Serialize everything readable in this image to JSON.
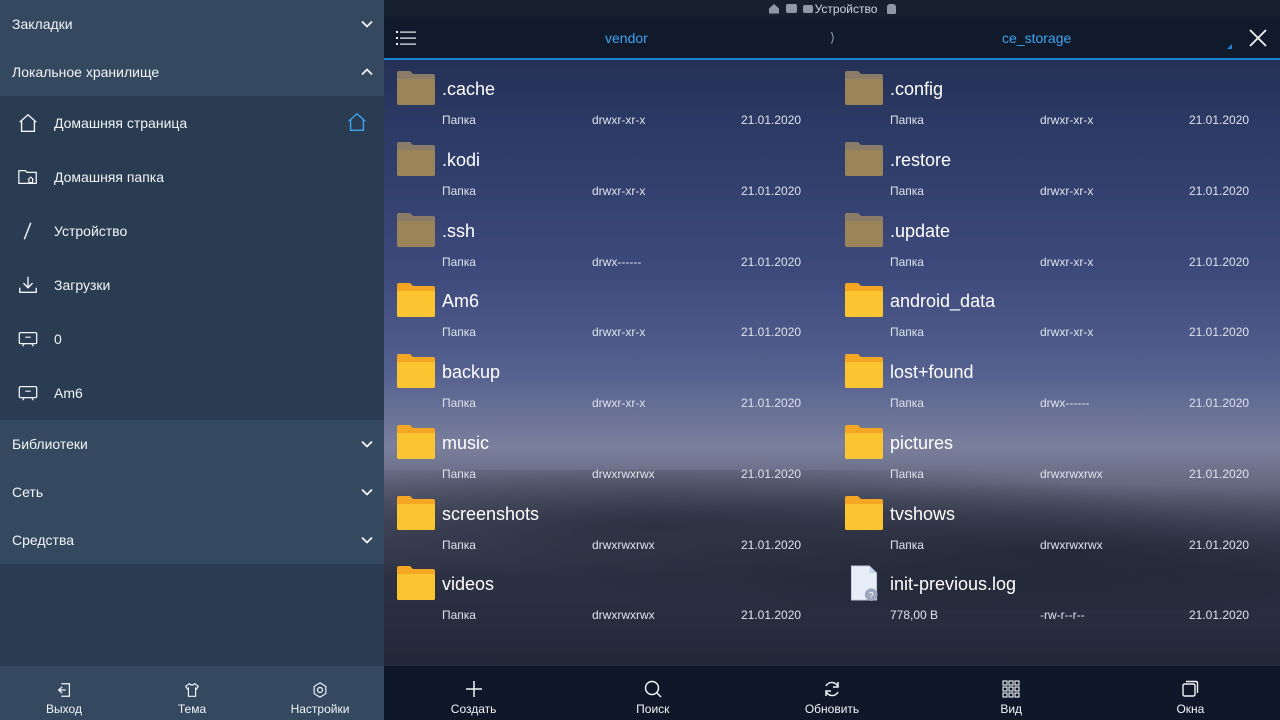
{
  "sidebar": {
    "sections": [
      {
        "label": "Закладки",
        "expanded": false
      },
      {
        "label": "Локальное хранилище",
        "expanded": true
      },
      {
        "label": "Библиотеки",
        "expanded": false
      },
      {
        "label": "Сеть",
        "expanded": false
      },
      {
        "label": "Средства",
        "expanded": false
      }
    ],
    "local_items": [
      {
        "label": "Домашняя страница",
        "icon": "home-icon"
      },
      {
        "label": "Домашняя папка",
        "icon": "home-folder-icon"
      },
      {
        "label": "Устройство",
        "icon": "slash-icon"
      },
      {
        "label": "Загрузки",
        "icon": "download-icon"
      },
      {
        "label": "0",
        "icon": "storage-icon"
      },
      {
        "label": "Am6",
        "icon": "storage-icon"
      }
    ],
    "footer": {
      "exit": "Выход",
      "theme": "Тема",
      "settings": "Настройки"
    }
  },
  "statusbar": {
    "device": "Устройство"
  },
  "toolbar": {
    "crumb1": "vendor",
    "separator": "⟩",
    "crumb2": "ce_storage"
  },
  "colors": {
    "accent": "#1b84d6",
    "sidebar": "#2a3c51",
    "header": "#34495f",
    "folder": "#fbc531",
    "folder_hidden": "#9a8458"
  },
  "files": [
    {
      "name": ".cache",
      "type": "Папка",
      "perm": "drwxr-xr-x",
      "date": "21.01.2020",
      "kind": "hidden"
    },
    {
      "name": ".config",
      "type": "Папка",
      "perm": "drwxr-xr-x",
      "date": "21.01.2020",
      "kind": "hidden"
    },
    {
      "name": ".kodi",
      "type": "Папка",
      "perm": "drwxr-xr-x",
      "date": "21.01.2020",
      "kind": "hidden"
    },
    {
      "name": ".restore",
      "type": "Папка",
      "perm": "drwxr-xr-x",
      "date": "21.01.2020",
      "kind": "hidden"
    },
    {
      "name": ".ssh",
      "type": "Папка",
      "perm": "drwx------",
      "date": "21.01.2020",
      "kind": "hidden"
    },
    {
      "name": ".update",
      "type": "Папка",
      "perm": "drwxr-xr-x",
      "date": "21.01.2020",
      "kind": "hidden"
    },
    {
      "name": "Am6",
      "type": "Папка",
      "perm": "drwxr-xr-x",
      "date": "21.01.2020",
      "kind": "folder"
    },
    {
      "name": "android_data",
      "type": "Папка",
      "perm": "drwxr-xr-x",
      "date": "21.01.2020",
      "kind": "folder"
    },
    {
      "name": "backup",
      "type": "Папка",
      "perm": "drwxr-xr-x",
      "date": "21.01.2020",
      "kind": "folder"
    },
    {
      "name": "lost+found",
      "type": "Папка",
      "perm": "drwx------",
      "date": "21.01.2020",
      "kind": "folder"
    },
    {
      "name": "music",
      "type": "Папка",
      "perm": "drwxrwxrwx",
      "date": "21.01.2020",
      "kind": "folder"
    },
    {
      "name": "pictures",
      "type": "Папка",
      "perm": "drwxrwxrwx",
      "date": "21.01.2020",
      "kind": "folder"
    },
    {
      "name": "screenshots",
      "type": "Папка",
      "perm": "drwxrwxrwx",
      "date": "21.01.2020",
      "kind": "folder"
    },
    {
      "name": "tvshows",
      "type": "Папка",
      "perm": "drwxrwxrwx",
      "date": "21.01.2020",
      "kind": "folder"
    },
    {
      "name": "videos",
      "type": "Папка",
      "perm": "drwxrwxrwx",
      "date": "21.01.2020",
      "kind": "folder"
    },
    {
      "name": "init-previous.log",
      "type": "778,00 B",
      "perm": "-rw-r--r--",
      "date": "21.01.2020",
      "kind": "file"
    }
  ],
  "main_footer": {
    "create": "Создать",
    "search": "Поиск",
    "refresh": "Обновить",
    "view": "Вид",
    "windows": "Окна"
  }
}
